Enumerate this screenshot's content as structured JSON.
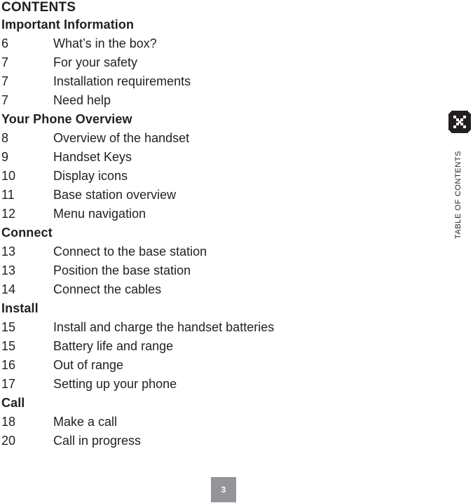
{
  "document": {
    "title": "CONTENTS",
    "page_number": "3",
    "side_tab_label": "TABLE OF CONTENTS",
    "tab_icon": "philips-shield-icon",
    "colors": {
      "text": "#231f20",
      "page_badge_background": "#93959b",
      "page_badge_text": "#ffffff",
      "tab_icon_background": "#231f20",
      "tab_icon_foreground": "#ffffff"
    }
  },
  "contents": [
    {
      "heading": "Important Information",
      "entries": [
        {
          "page": "6",
          "label": "What’s in the box?"
        },
        {
          "page": "7",
          "label": "For your safety"
        },
        {
          "page": "7",
          "label": "Installation requirements"
        },
        {
          "page": "7",
          "label": "Need help"
        }
      ]
    },
    {
      "heading": "Your Phone Overview",
      "entries": [
        {
          "page": "8",
          "label": "Overview of the handset"
        },
        {
          "page": "9",
          "label": "Handset Keys"
        },
        {
          "page": "10",
          "label": "Display icons"
        },
        {
          "page": "11",
          "label": "Base station overview"
        },
        {
          "page": "12",
          "label": "Menu navigation"
        }
      ]
    },
    {
      "heading": "Connect",
      "entries": [
        {
          "page": "13",
          "label": "Connect to the base station"
        },
        {
          "page": "13",
          "label": "Position the base station"
        },
        {
          "page": "14",
          "label": "Connect the cables"
        }
      ]
    },
    {
      "heading": "Install",
      "entries": [
        {
          "page": "15",
          "label": "Install and charge the handset batteries"
        },
        {
          "page": "15",
          "label": "Battery life and range"
        },
        {
          "page": "16",
          "label": "Out of range"
        },
        {
          "page": "17",
          "label": "Setting up your phone"
        }
      ]
    },
    {
      "heading": "Call",
      "entries": [
        {
          "page": "18",
          "label": "Make a call"
        },
        {
          "page": "20",
          "label": "Call in progress"
        }
      ]
    }
  ]
}
